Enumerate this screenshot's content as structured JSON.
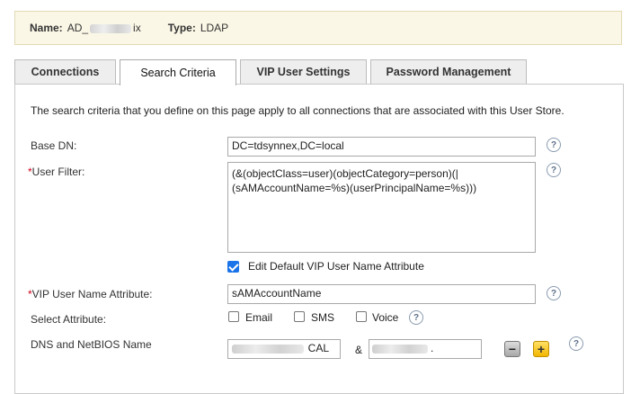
{
  "store": {
    "name_label": "Name:",
    "name_prefix": "AD_",
    "name_suffix": "ix",
    "type_label": "Type:",
    "type_value": "LDAP"
  },
  "tabs": [
    {
      "label": "Connections",
      "active": false
    },
    {
      "label": "Search Criteria",
      "active": true
    },
    {
      "label": "VIP User Settings",
      "active": false
    },
    {
      "label": "Password Management",
      "active": false
    }
  ],
  "form": {
    "description": "The search criteria that you define on this page apply to all connections that are associated with this User Store.",
    "base_dn": {
      "label": "Base DN:",
      "value": "DC=tdsynnex,DC=local"
    },
    "user_filter": {
      "required_mark": "*",
      "label": "User Filter:",
      "value": "(&(objectClass=user)(objectCategory=person)(|\n(sAMAccountName=%s)(userPrincipalName=%s)))"
    },
    "edit_default": {
      "label": "Edit Default VIP User Name Attribute",
      "checked": true
    },
    "vip_attr": {
      "required_mark": "*",
      "label": "VIP User Name Attribute:",
      "value": "sAMAccountName"
    },
    "select_attr": {
      "label": "Select Attribute:",
      "options": [
        {
          "label": "Email",
          "checked": false
        },
        {
          "label": "SMS",
          "checked": false
        },
        {
          "label": "Voice",
          "checked": false
        }
      ]
    },
    "dns": {
      "label": "DNS and NetBIOS Name",
      "dns_value_suffix": "CAL",
      "separator": "&",
      "netbios_value_suffix": "."
    },
    "help_glyph": "?",
    "minus_glyph": "−",
    "plus_glyph": "+"
  }
}
